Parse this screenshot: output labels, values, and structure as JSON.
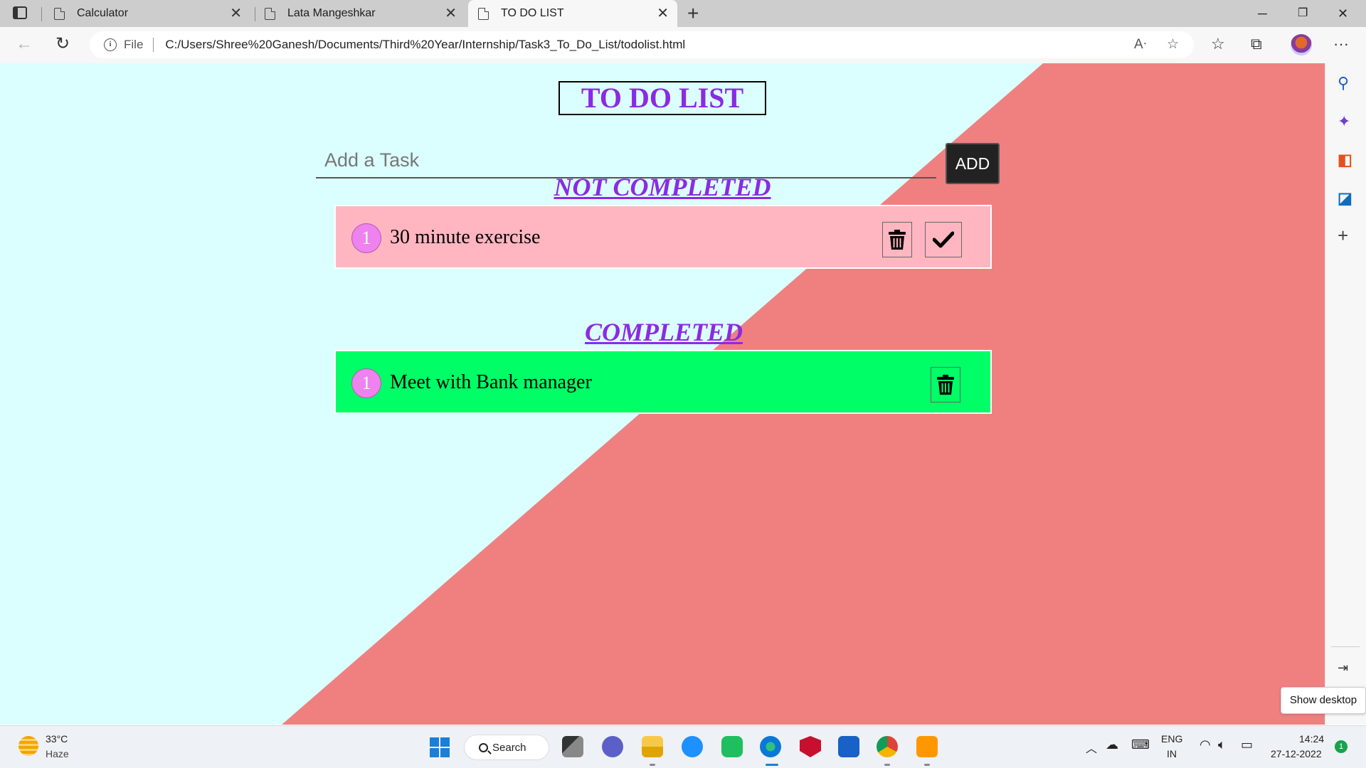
{
  "browser": {
    "tabs": [
      {
        "title": "Calculator",
        "active": false
      },
      {
        "title": "Lata Mangeshkar",
        "active": false
      },
      {
        "title": "TO DO LIST",
        "active": true
      }
    ],
    "address": {
      "scheme_label": "File",
      "url": "C:/Users/Shree%20Ganesh/Documents/Third%20Year/Internship/Task3_To_Do_List/todolist.html"
    }
  },
  "page": {
    "title": "TO DO LIST",
    "input": {
      "placeholder": "Add a Task",
      "value": ""
    },
    "add_label": "ADD",
    "not_completed": {
      "heading": "NOT COMPLETED",
      "items": [
        {
          "number": "1",
          "text": "30 minute exercise"
        }
      ]
    },
    "completed": {
      "heading": "COMPLETED",
      "items": [
        {
          "number": "1",
          "text": "Meet with Bank manager"
        }
      ]
    },
    "colors": {
      "background_left": "#dbfffe",
      "background_right": "#f08080",
      "heading": "#8a2be2",
      "not_completed_card": "#ffb6c1",
      "completed_card": "#00ff66",
      "number_badge": "#ee82ee",
      "add_button": "#222222"
    }
  },
  "sidebar_tooltip": "Show desktop",
  "taskbar": {
    "weather": {
      "temp": "33°C",
      "desc": "Haze"
    },
    "search_label": "Search",
    "language": {
      "line1": "ENG",
      "line2": "IN"
    },
    "time": "14:24",
    "date": "27-12-2022",
    "notification_count": "1"
  }
}
